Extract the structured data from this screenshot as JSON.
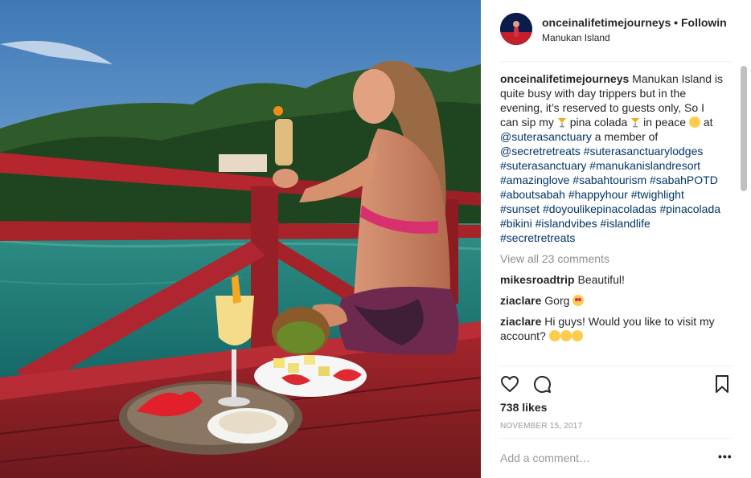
{
  "post": {
    "username": "onceinalifetimejourneys",
    "separator": "•",
    "follow_label": "Followin",
    "location": "Manukan Island"
  },
  "caption": {
    "username": "onceinalifetimejourneys",
    "text_1": "Manukan Island is quite busy with day trippers but in the evening, it’s reserved to guests only, So I can sip my",
    "text_2": "pina colada",
    "text_3": "in peace",
    "text_4": "at",
    "mention_1": "@suterasanctuary",
    "text_5": "a member of",
    "mention_2": "@secretretreats",
    "hashtags": [
      "#suterasanctuarylodges",
      "#suterasanctuary",
      "#manukanislandresort",
      "#amazinglove",
      "#sabahtourism",
      "#sabahPOTD",
      "#aboutsabah",
      "#happyhour",
      "#twighlight",
      "#sunset",
      "#doyoulikepinacoladas",
      "#pinacolada",
      "#bikini",
      "#islandvibes",
      "#islandlife",
      "#secretretreats"
    ]
  },
  "view_all_comments": "View all 23 comments",
  "comments": [
    {
      "username": "mikesroadtrip",
      "text": "Beautiful!"
    },
    {
      "username": "ziaclare",
      "text": "Gorg"
    },
    {
      "username": "ziaclare",
      "text": "Hi guys! Would you like to visit my account?"
    }
  ],
  "likes": "738 likes",
  "date": "NOVEMBER 15, 2017",
  "add_comment_placeholder": "Add a comment…",
  "more_label": "•••",
  "icons": {
    "like": "heart-icon",
    "comment": "comment-icon",
    "save": "bookmark-icon",
    "more": "more-options-icon"
  },
  "colors": {
    "hashtag": "#003569",
    "muted": "#8e8e8e",
    "text": "#262626"
  }
}
